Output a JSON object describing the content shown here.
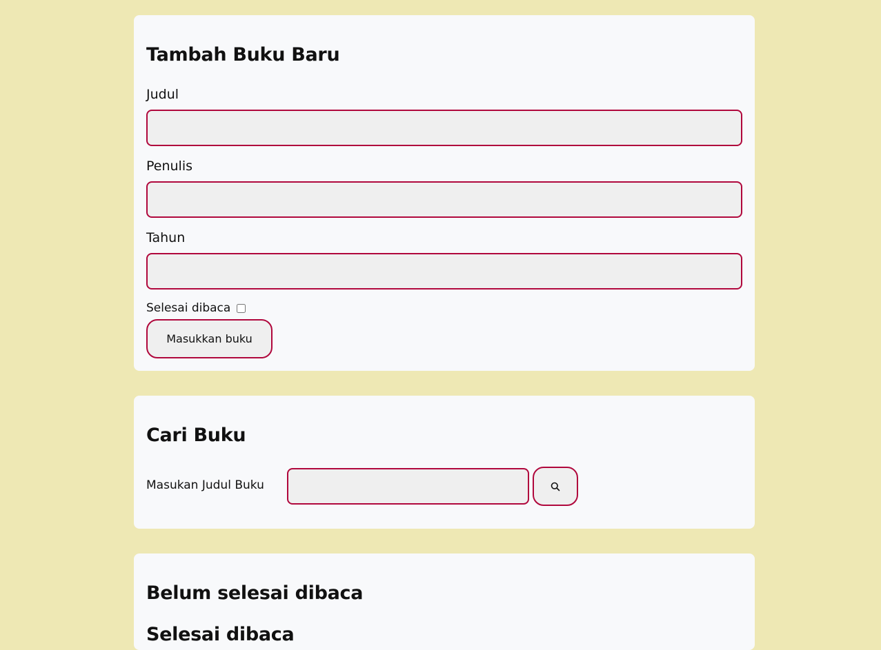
{
  "add_form": {
    "title": "Tambah Buku Baru",
    "title_label": "Judul",
    "title_value": "",
    "author_label": "Penulis",
    "author_value": "",
    "year_label": "Tahun",
    "year_value": "",
    "complete_label": "Selesai dibaca",
    "complete_checked": false,
    "submit_label": "Masukkan buku"
  },
  "search": {
    "title": "Cari Buku",
    "label": "Masukan Judul Buku",
    "value": "",
    "button_icon": "search-icon"
  },
  "shelves": {
    "incomplete_title": "Belum selesai dibaca",
    "complete_title": "Selesai dibaca"
  },
  "colors": {
    "background": "#eee8b4",
    "card": "#f8f9fb",
    "accent_border": "#b0073c",
    "input_fill": "#efefef"
  }
}
